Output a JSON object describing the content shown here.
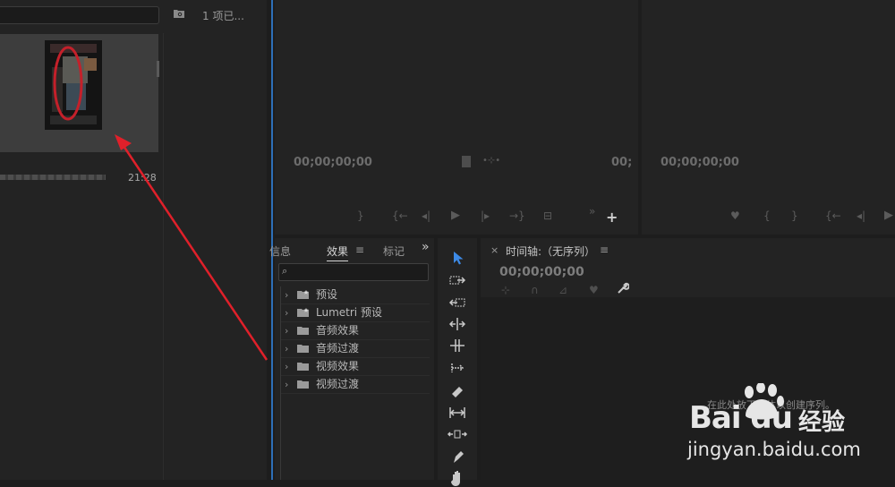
{
  "project_panel": {
    "item_count": "1 项已...",
    "clip_duration": "21:28"
  },
  "source_monitor": {
    "timecode_left": "00;00;00;00",
    "timecode_right": "00;"
  },
  "program_monitor": {
    "timecode_left": "00;00;00;00"
  },
  "effects_panel": {
    "tabs": [
      {
        "label": "信息"
      },
      {
        "label": "效果"
      },
      {
        "label": "标记"
      }
    ],
    "items": [
      {
        "label": "预设"
      },
      {
        "label": "Lumetri 预设"
      },
      {
        "label": "音频效果"
      },
      {
        "label": "音频过渡"
      },
      {
        "label": "视频效果"
      },
      {
        "label": "视频过渡"
      }
    ]
  },
  "timeline": {
    "title": "时间轴:（无序列）",
    "timecode": "00;00;00;00",
    "empty_message": "在此处放下媒体以创建序列。"
  },
  "watermark": {
    "logo": "Bai du",
    "logo_cn": "经验",
    "url": "jingyan.baidu.com"
  },
  "colors": {
    "accent_blue": "#2d6fb8",
    "annotation_red": "#e0202a"
  }
}
